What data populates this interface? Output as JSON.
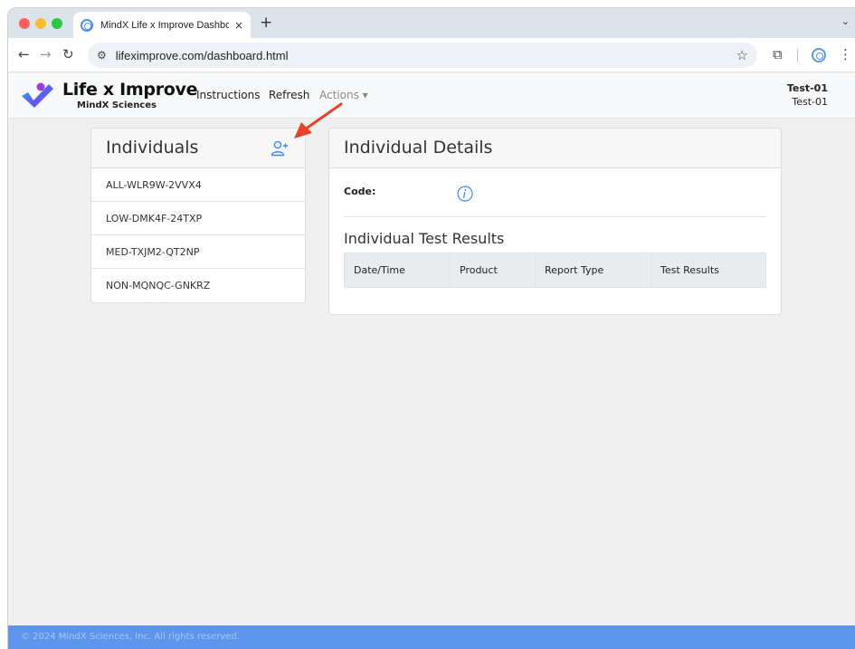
{
  "browser": {
    "tab_title": "MindX Life x Improve Dashboard",
    "tab_close": "×",
    "new_tab": "+",
    "tab_menu": "⌄",
    "url": "lifeximprove.com/dashboard.html",
    "icons": [
      "back-arrow-icon",
      "forward-arrow-icon",
      "reload-icon",
      "site-info-icon",
      "star-icon",
      "extensions-icon",
      "profile-icon",
      "menu-icon"
    ]
  },
  "app": {
    "brand_title": "Life x Improve",
    "brand_subtitle": "MindX Sciences",
    "nav": {
      "instructions": "Instructions",
      "refresh": "Refresh",
      "actions": "Actions ▾"
    },
    "user": {
      "line1": "Test-01",
      "line2": "Test-01"
    },
    "colors": {
      "accent": "#3d8bf0",
      "footer": "#5e95ec",
      "arrow": "#e8412a"
    }
  },
  "individuals": {
    "title": "Individuals",
    "items": [
      "ALL-WLR9W-2VVX4",
      "LOW-DMK4F-24TXP",
      "MED-TXJM2-QT2NP",
      "NON-MQNQC-GNKRZ"
    ]
  },
  "details": {
    "title": "Individual Details",
    "code_label": "Code:",
    "results_title": "Individual Test Results",
    "columns": [
      "Date/Time",
      "Product",
      "Report Type",
      "Test Results"
    ]
  },
  "footer": {
    "text": "© 2024 MindX Sciences, Inc. All rights reserved."
  }
}
